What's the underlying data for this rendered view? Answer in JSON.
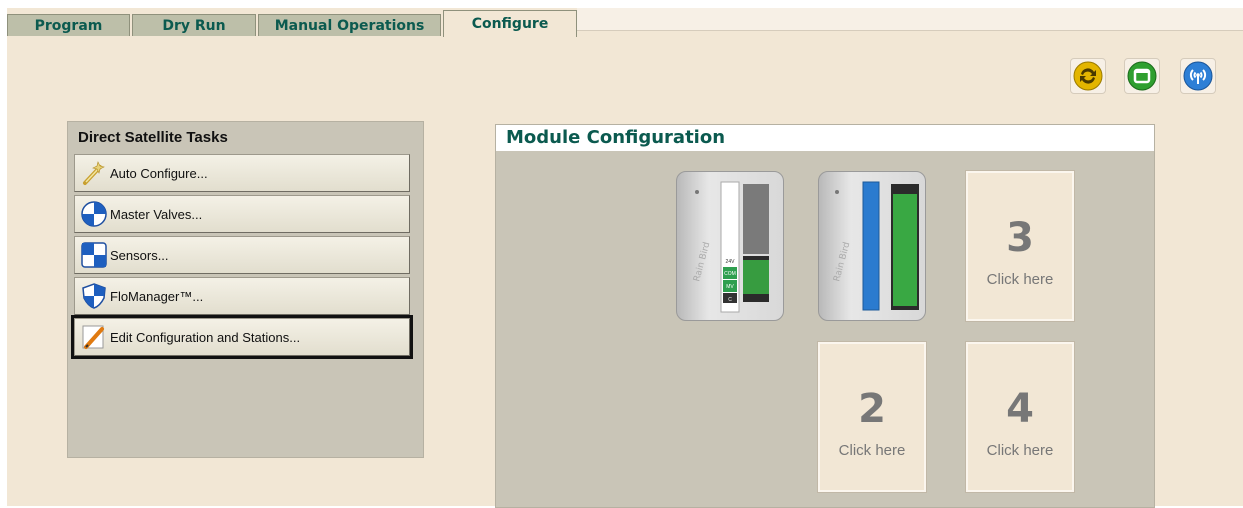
{
  "tabs": [
    {
      "label": "Program",
      "active": false
    },
    {
      "label": "Dry Run",
      "active": false
    },
    {
      "label": "Manual Operations",
      "active": false
    },
    {
      "label": "Configure",
      "active": true
    }
  ],
  "toolbar": {
    "icons": [
      "refresh-icon",
      "window-icon",
      "wireless-icon"
    ],
    "colors": {
      "refresh": "#e0b800",
      "window": "#2f9f2f",
      "wireless": "#2d7fd6"
    }
  },
  "tasks_panel": {
    "title": "Direct Satellite Tasks",
    "buttons": [
      {
        "label": "Auto Configure...",
        "icon": "wand-icon"
      },
      {
        "label": "Master Valves...",
        "icon": "master-valve-icon"
      },
      {
        "label": "Sensors...",
        "icon": "sensor-icon"
      },
      {
        "label": "FloManager™...",
        "icon": "shield-icon"
      },
      {
        "label": "Edit Configuration and Stations...",
        "icon": "pencil-icon",
        "selected": true
      }
    ]
  },
  "module_config": {
    "title": "Module Configuration",
    "slots": [
      {
        "number": "3",
        "label": "Click here"
      },
      {
        "number": "2",
        "label": "Click here"
      },
      {
        "number": "4",
        "label": "Click here"
      }
    ],
    "modules": [
      {
        "name": "base-module",
        "labels": [
          "24V",
          "COM",
          "MV",
          "C"
        ]
      },
      {
        "name": "station-module",
        "color": "#2b7bcf"
      }
    ]
  },
  "colors": {
    "background": "#f2e7d5",
    "tab_text": "#0b5a4f",
    "panel": "#c9c5b7"
  }
}
